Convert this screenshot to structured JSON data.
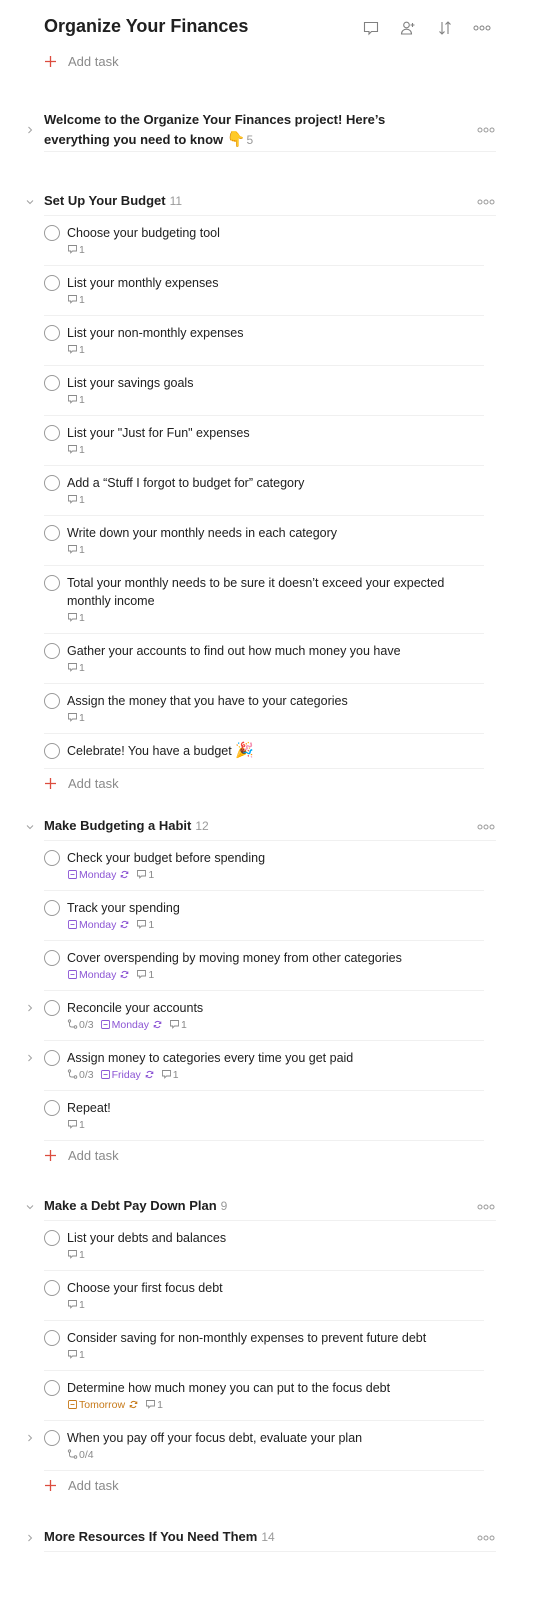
{
  "header": {
    "title": "Organize Your Finances",
    "actions": [
      {
        "name": "comments",
        "icon": "comment-icon"
      },
      {
        "name": "share",
        "icon": "add-person-icon"
      },
      {
        "name": "sort",
        "icon": "sort-icon"
      },
      {
        "name": "more",
        "icon": "more-icon"
      }
    ]
  },
  "add_task_label": "Add task",
  "sections": [
    {
      "title": "Welcome to the Organize Your Finances project! Here’s everything you need to know",
      "emoji": "👇",
      "count": "5",
      "collapsed": true
    },
    {
      "title": "Set Up Your Budget",
      "count": "11",
      "collapsed": false,
      "tasks": [
        {
          "text": "Choose your budgeting tool",
          "comments": "1"
        },
        {
          "text": "List your monthly expenses",
          "comments": "1"
        },
        {
          "text": "List your non-monthly expenses",
          "comments": "1"
        },
        {
          "text": "List your savings goals",
          "comments": "1"
        },
        {
          "text": "List your \"Just for Fun\" expenses",
          "comments": "1"
        },
        {
          "text": "Add a “Stuff I forgot to budget for” category",
          "comments": "1"
        },
        {
          "text": "Write down your monthly needs in each category",
          "comments": "1"
        },
        {
          "text": "Total your monthly needs to be sure it doesn’t exceed your expected monthly income",
          "comments": "1"
        },
        {
          "text": "Gather your accounts to find out how much money you have",
          "comments": "1"
        },
        {
          "text": "Assign the money that you have to your categories",
          "comments": "1"
        },
        {
          "text": "Celebrate! You have a budget",
          "emoji": "🎉"
        }
      ]
    },
    {
      "title": "Make Budgeting a Habit",
      "count": "12",
      "collapsed": false,
      "tasks": [
        {
          "text": "Check your budget before spending",
          "date": "Monday",
          "recurring": true,
          "comments": "1"
        },
        {
          "text": "Track your spending",
          "date": "Monday",
          "recurring": true,
          "comments": "1"
        },
        {
          "text": "Cover overspending by moving money from other categories",
          "date": "Monday",
          "recurring": true,
          "comments": "1"
        },
        {
          "text": "Reconcile your accounts",
          "subtasks": "0/3",
          "date": "Monday",
          "recurring": true,
          "comments": "1",
          "has_children": true
        },
        {
          "text": "Assign money to categories every time you get paid",
          "subtasks": "0/3",
          "date": "Friday",
          "recurring": true,
          "comments": "1",
          "has_children": true
        },
        {
          "text": "Repeat!",
          "comments": "1"
        }
      ]
    },
    {
      "title": "Make a Debt Pay Down Plan",
      "count": "9",
      "collapsed": false,
      "tasks": [
        {
          "text": "List your debts and balances",
          "comments": "1"
        },
        {
          "text": "Choose your first focus debt",
          "comments": "1"
        },
        {
          "text": "Consider saving for non-monthly expenses to prevent future debt",
          "comments": "1"
        },
        {
          "text": "Determine how much money you can put to the focus debt",
          "date": "Tomorrow",
          "recurring": true,
          "comments": "1",
          "date_color": "#c77a1a"
        },
        {
          "text": "When you pay off your focus debt, evaluate your plan",
          "subtasks": "0/4",
          "has_children": true
        }
      ]
    },
    {
      "title": "More Resources If You Need Them",
      "count": "14",
      "collapsed": true
    }
  ],
  "colors": {
    "accent_add": "#dc4c3e",
    "date_purple": "#8c55d4",
    "date_orange": "#c77a1a",
    "muted": "#8a8a8a",
    "separator": "#f0f0f0"
  }
}
